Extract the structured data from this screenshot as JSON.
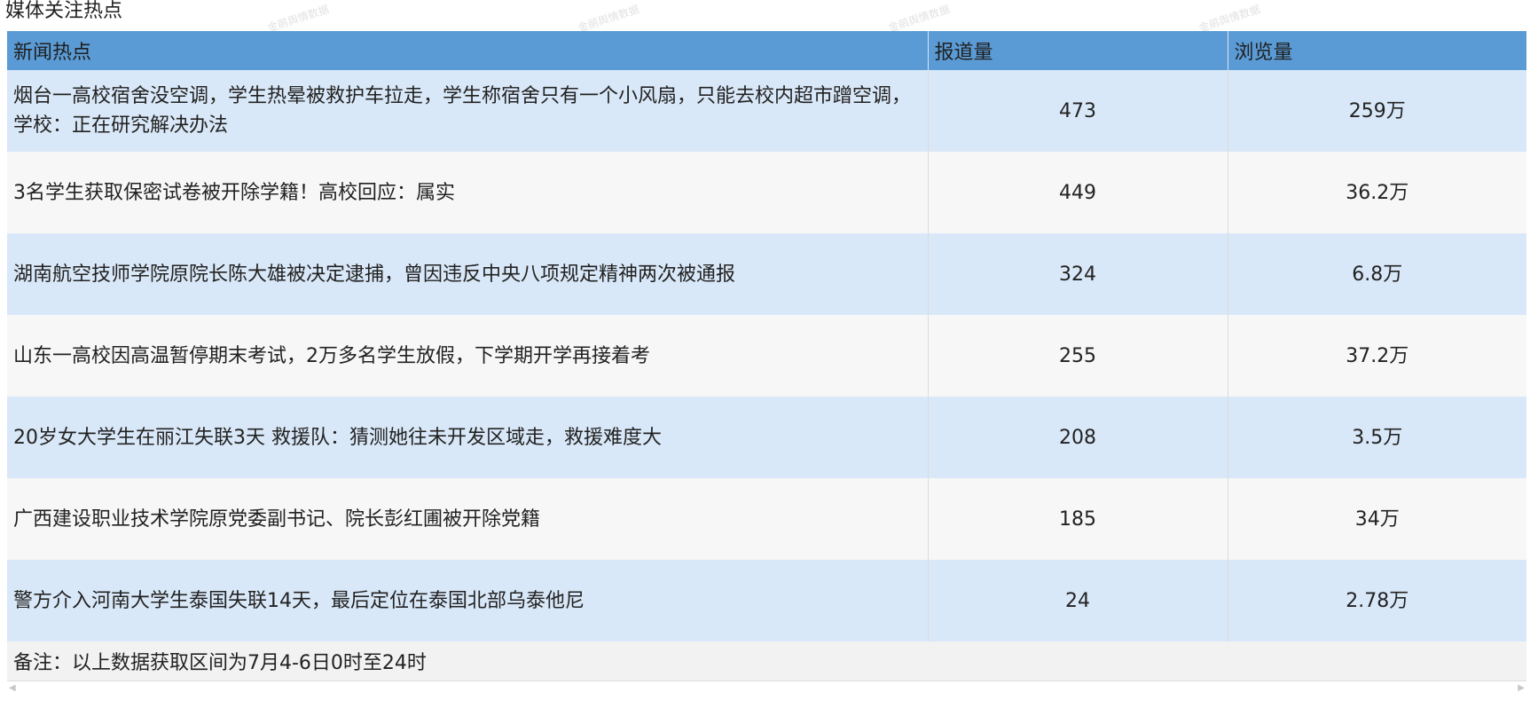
{
  "page": {
    "title": "媒体关注热点"
  },
  "watermark": {
    "text": "金鹃舆情数据"
  },
  "table": {
    "headers": [
      "新闻热点",
      "报道量",
      "浏览量"
    ],
    "rows": [
      {
        "topic": "烟台一高校宿舍没空调，学生热晕被救护车拉走，学生称宿舍只有一个小风扇，只能去校内超市蹭空调，学校：正在研究解决办法",
        "reports": "473",
        "views": "259万"
      },
      {
        "topic": "3名学生获取保密试卷被开除学籍！高校回应：属实",
        "reports": "449",
        "views": "36.2万"
      },
      {
        "topic": "湖南航空技师学院原院长陈大雄被决定逮捕，曾因违反中央八项规定精神两次被通报",
        "reports": "324",
        "views": "6.8万"
      },
      {
        "topic": "山东一高校因高温暂停期末考试，2万多名学生放假，下学期开学再接着考",
        "reports": "255",
        "views": "37.2万"
      },
      {
        "topic": "20岁女大学生在丽江失联3天 救援队：猜测她往未开发区域走，救援难度大",
        "reports": "208",
        "views": "3.5万"
      },
      {
        "topic": "广西建设职业技术学院原党委副书记、院长彭红圃被开除党籍",
        "reports": "185",
        "views": "34万"
      },
      {
        "topic": "警方介入河南大学生泰国失联14天，最后定位在泰国北部乌泰他尼",
        "reports": "24",
        "views": "2.78万"
      }
    ],
    "footnote": "备注：以上数据获取区间为7月4-6日0时至24时"
  },
  "colors": {
    "header_bg": "#5b9bd5",
    "row_odd_bg": "#d9e8f8",
    "row_even_bg": "#f7f7f7",
    "footer_bg": "#f2f2f2"
  },
  "icons": {
    "scroll_left": "caret-left-icon",
    "scroll_right": "caret-right-icon"
  }
}
